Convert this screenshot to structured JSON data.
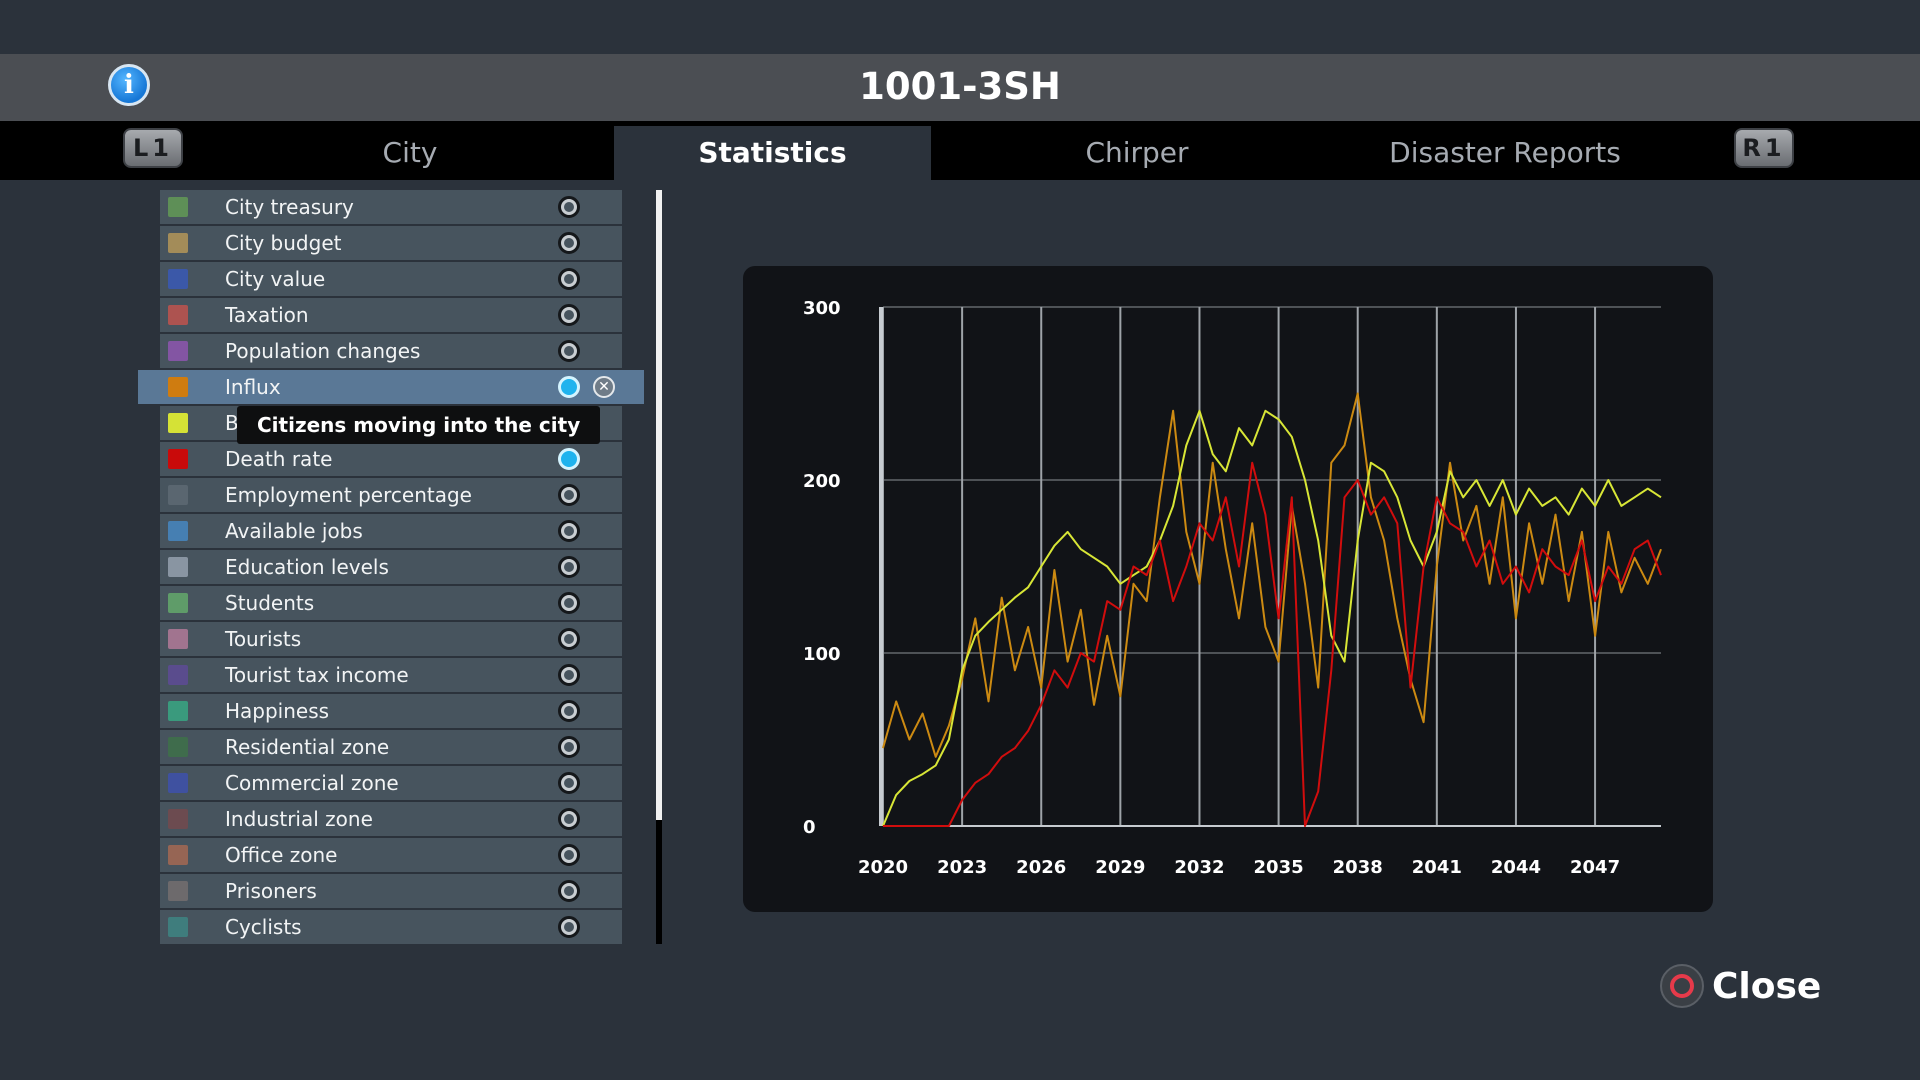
{
  "window": {
    "title": "1001-3SH"
  },
  "tabs": [
    {
      "label": "City",
      "active": false
    },
    {
      "label": "Statistics",
      "active": true
    },
    {
      "label": "Chirper",
      "active": false
    },
    {
      "label": "Disaster Reports",
      "active": false
    }
  ],
  "shoulder_left": "L1",
  "shoulder_right": "R1",
  "stats": [
    {
      "label": "City treasury",
      "color": "#5e8f57",
      "selected": false
    },
    {
      "label": "City budget",
      "color": "#a38c59",
      "selected": false
    },
    {
      "label": "City value",
      "color": "#3b58a8",
      "selected": false
    },
    {
      "label": "Taxation",
      "color": "#ad5350",
      "selected": false
    },
    {
      "label": "Population changes",
      "color": "#8355a3",
      "selected": false
    },
    {
      "label": "Influx",
      "color": "#cf7c10",
      "selected": true
    },
    {
      "label": "B",
      "color": "#d5e236",
      "selected": true
    },
    {
      "label": "Death rate",
      "color": "#c90a0a",
      "selected": true
    },
    {
      "label": "Employment percentage",
      "color": "#5a6670",
      "selected": false
    },
    {
      "label": "Available jobs",
      "color": "#467fb2",
      "selected": false
    },
    {
      "label": "Education levels",
      "color": "#8995a2",
      "selected": false
    },
    {
      "label": "Students",
      "color": "#5f9c69",
      "selected": false
    },
    {
      "label": "Tourists",
      "color": "#a1748f",
      "selected": false
    },
    {
      "label": "Tourist tax income",
      "color": "#5a4c8d",
      "selected": false
    },
    {
      "label": "Happiness",
      "color": "#3a9a7d",
      "selected": false
    },
    {
      "label": "Residential zone",
      "color": "#3f6c4c",
      "selected": false
    },
    {
      "label": "Commercial zone",
      "color": "#3f51a0",
      "selected": false
    },
    {
      "label": "Industrial zone",
      "color": "#6c4b50",
      "selected": false
    },
    {
      "label": "Office zone",
      "color": "#966554",
      "selected": false
    },
    {
      "label": "Prisoners",
      "color": "#6d6a6c",
      "selected": false
    },
    {
      "label": "Cyclists",
      "color": "#3f7d7d",
      "selected": false
    }
  ],
  "tooltip": "Citizens moving into the city",
  "close_label": "Close",
  "chart_data": {
    "type": "line",
    "ylim": [
      0,
      300
    ],
    "yticks": [
      0,
      100,
      200,
      300
    ],
    "xlim": [
      2020,
      2049.5
    ],
    "xticks": [
      2020,
      2023,
      2026,
      2029,
      2032,
      2035,
      2038,
      2041,
      2044,
      2047
    ],
    "grid": true,
    "series": [
      {
        "color": "#cc8a12",
        "x": [
          2020,
          2020.5,
          2021,
          2021.5,
          2022,
          2022.5,
          2023,
          2023.5,
          2024,
          2024.5,
          2025,
          2025.5,
          2026,
          2026.5,
          2027,
          2027.5,
          2028,
          2028.5,
          2029,
          2029.5,
          2030,
          2030.5,
          2031,
          2031.5,
          2032,
          2032.5,
          2033,
          2033.5,
          2034,
          2034.5,
          2035,
          2035.5,
          2036,
          2036.5,
          2037,
          2037.5,
          2038,
          2038.5,
          2039,
          2039.5,
          2040,
          2040.5,
          2041,
          2041.5,
          2042,
          2042.5,
          2043,
          2043.5,
          2044,
          2044.5,
          2045,
          2045.5,
          2046,
          2046.5,
          2047,
          2047.5,
          2048,
          2048.5,
          2049,
          2049.5
        ],
        "values": [
          45,
          72,
          50,
          65,
          40,
          58,
          85,
          120,
          72,
          132,
          90,
          115,
          80,
          148,
          95,
          125,
          70,
          110,
          75,
          140,
          130,
          190,
          240,
          170,
          140,
          210,
          160,
          120,
          175,
          115,
          95,
          185,
          140,
          80,
          210,
          220,
          250,
          190,
          165,
          120,
          85,
          60,
          150,
          210,
          165,
          185,
          140,
          190,
          120,
          175,
          140,
          180,
          130,
          170,
          110,
          170,
          135,
          155,
          140,
          160
        ]
      },
      {
        "color": "#d8e636",
        "x": [
          2020,
          2020.5,
          2021,
          2021.5,
          2022,
          2022.5,
          2023,
          2023.5,
          2024,
          2024.5,
          2025,
          2025.5,
          2026,
          2026.5,
          2027,
          2027.5,
          2028,
          2028.5,
          2029,
          2029.5,
          2030,
          2030.5,
          2031,
          2031.5,
          2032,
          2032.5,
          2033,
          2033.5,
          2034,
          2034.5,
          2035,
          2035.5,
          2036,
          2036.5,
          2037,
          2037.5,
          2038,
          2038.5,
          2039,
          2039.5,
          2040,
          2040.5,
          2041,
          2041.5,
          2042,
          2042.5,
          2043,
          2043.5,
          2044,
          2044.5,
          2045,
          2045.5,
          2046,
          2046.5,
          2047,
          2047.5,
          2048,
          2048.5,
          2049,
          2049.5
        ],
        "values": [
          0,
          18,
          26,
          30,
          35,
          50,
          90,
          110,
          118,
          125,
          132,
          138,
          150,
          162,
          170,
          160,
          155,
          150,
          140,
          145,
          150,
          165,
          185,
          220,
          240,
          215,
          205,
          230,
          220,
          240,
          235,
          225,
          200,
          165,
          110,
          95,
          165,
          210,
          205,
          190,
          165,
          150,
          170,
          205,
          190,
          200,
          185,
          200,
          180,
          195,
          185,
          190,
          180,
          195,
          185,
          200,
          185,
          190,
          195,
          190
        ]
      },
      {
        "color": "#d10d0d",
        "x": [
          2020,
          2020.5,
          2021,
          2021.5,
          2022,
          2022.5,
          2023,
          2023.5,
          2024,
          2024.5,
          2025,
          2025.5,
          2026,
          2026.5,
          2027,
          2027.5,
          2028,
          2028.5,
          2029,
          2029.5,
          2030,
          2030.5,
          2031,
          2031.5,
          2032,
          2032.5,
          2033,
          2033.5,
          2034,
          2034.5,
          2035,
          2035.5,
          2036,
          2036.5,
          2037,
          2037.5,
          2038,
          2038.5,
          2039,
          2039.5,
          2040,
          2040.5,
          2041,
          2041.5,
          2042,
          2042.5,
          2043,
          2043.5,
          2044,
          2044.5,
          2045,
          2045.5,
          2046,
          2046.5,
          2047,
          2047.5,
          2048,
          2048.5,
          2049,
          2049.5
        ],
        "values": [
          0,
          0,
          0,
          0,
          0,
          0,
          15,
          25,
          30,
          40,
          45,
          55,
          70,
          90,
          80,
          100,
          95,
          130,
          125,
          150,
          145,
          165,
          130,
          150,
          175,
          165,
          190,
          150,
          210,
          180,
          120,
          190,
          0,
          20,
          90,
          190,
          200,
          180,
          190,
          175,
          80,
          150,
          190,
          175,
          170,
          150,
          165,
          140,
          150,
          135,
          160,
          150,
          145,
          165,
          130,
          150,
          140,
          160,
          165,
          145
        ]
      }
    ]
  }
}
